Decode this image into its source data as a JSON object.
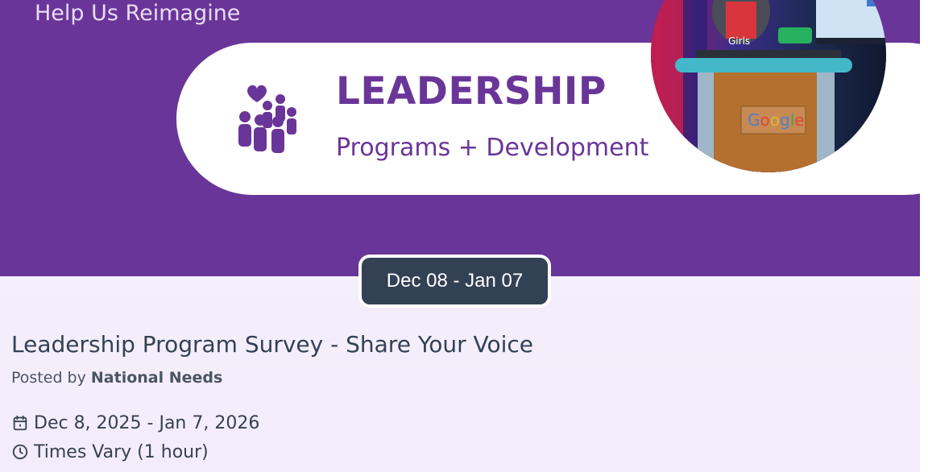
{
  "banner": {
    "heading": "Help Us Reimagine",
    "pill_title": "LEADERSHIP",
    "pill_subtitle": "Programs + Development",
    "podium_logo": "Google",
    "icons": {
      "people": "group-heart-icon"
    },
    "colors": {
      "purple": "#6a3598",
      "pill_bg": "#ffffff"
    }
  },
  "date_chip": {
    "label": "Dec 08 - Jan 07"
  },
  "event": {
    "title": "Leadership Program Survey - Share Your Voice",
    "posted_by_prefix": "Posted by",
    "posted_by_name": "National Needs",
    "date_range": "Dec 8, 2025 - Jan 7, 2026",
    "times": "Times Vary (1 hour)",
    "icons": {
      "date": "calendar-icon",
      "time": "clock-icon"
    }
  }
}
